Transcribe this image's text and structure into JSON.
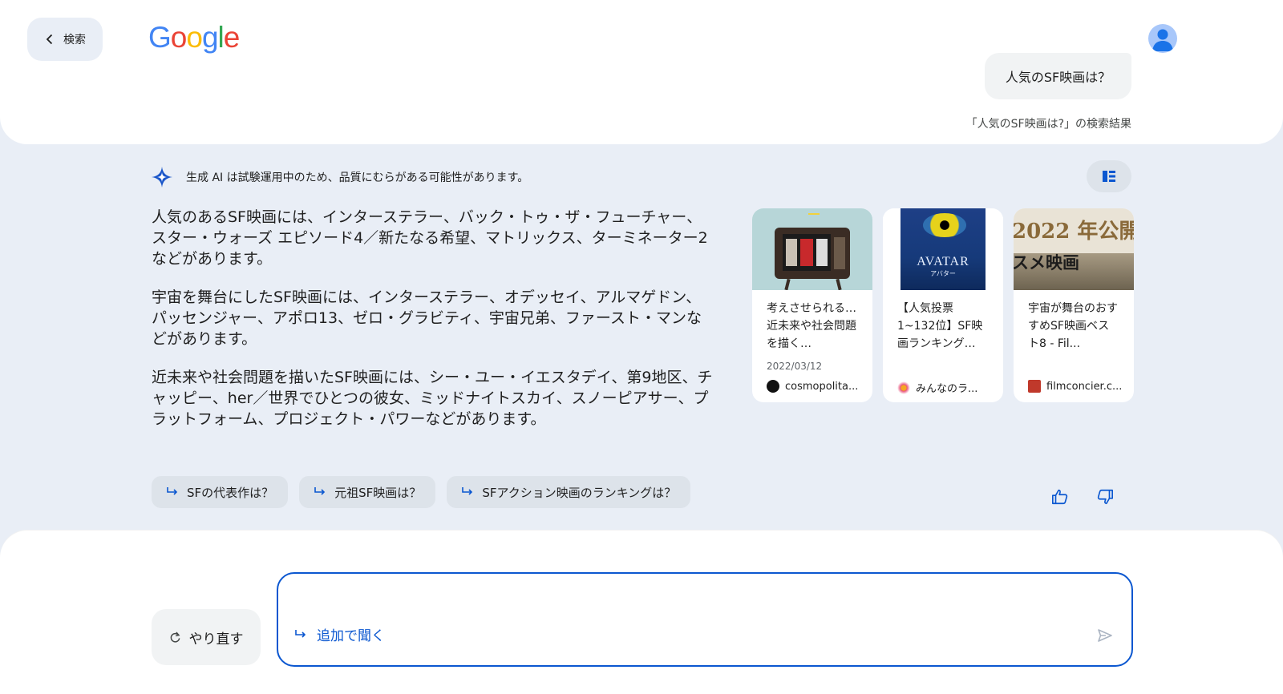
{
  "header": {
    "back_label": "検索",
    "logo_text": "Google",
    "query": "人気のSF映画は？",
    "results_link": "「人気のSF映画は?」の検索結果"
  },
  "ai": {
    "notice": "生成 AI は試験運用中のため、品質にむらがある可能性があります。",
    "paragraphs": [
      "人気のあるSF映画には、インターステラー、バック・トゥ・ザ・フューチャー、スター・ウォーズ エピソード4／新たなる希望、マトリックス、ターミネーター2などがあります。",
      "宇宙を舞台にしたSF映画には、インターステラー、オデッセイ、アルマゲドン、パッセンジャー、アポロ13、ゼロ・グラビティ、宇宙兄弟、ファースト・マンなどがあります。",
      "近未来や社会問題を描いたSF映画には、シー・ユー・イエスタデイ、第9地区、チャッピー、her／世界でひとつの彼女、ミッドナイトスカイ、スノーピアサー、プラットフォーム、プロジェクト・パワーなどがあります。"
    ]
  },
  "cards": [
    {
      "title": "考えさせられる…近未来や社会問題を描く…",
      "date": "2022/03/12",
      "source": "cosmopolita..."
    },
    {
      "title": "【人気投票 1~132位】SF映画ランキング…",
      "date": "",
      "source": "みんなのラ..."
    },
    {
      "title": "宇宙が舞台のおすすめSF映画ベスト8 - Fil...",
      "date": "",
      "source": "filmconcier.c...",
      "thumb_text": "2022 年公開",
      "thumb_text2": "スメ映画"
    }
  ],
  "card2_thumb": {
    "title": "AVATAR",
    "subtitle": "アバター"
  },
  "chips": [
    "SFの代表作は？",
    "元祖SF映画は？",
    "SFアクション映画のランキングは？"
  ],
  "footer": {
    "redo_label": "やり直す",
    "ask_label": "追加で聞く"
  },
  "colors": {
    "background": "#e9eef6",
    "accent": "#0b57d0",
    "chip": "#dde3ea"
  },
  "icons": {
    "back": "chevron-left-icon",
    "sparkle": "gemini-sparkle-icon",
    "layout": "layout-toggle-icon",
    "followup": "subdirectory-arrow-icon",
    "like": "thumb-up-icon",
    "dislike": "thumb-down-icon",
    "redo": "refresh-icon",
    "send": "send-icon"
  }
}
